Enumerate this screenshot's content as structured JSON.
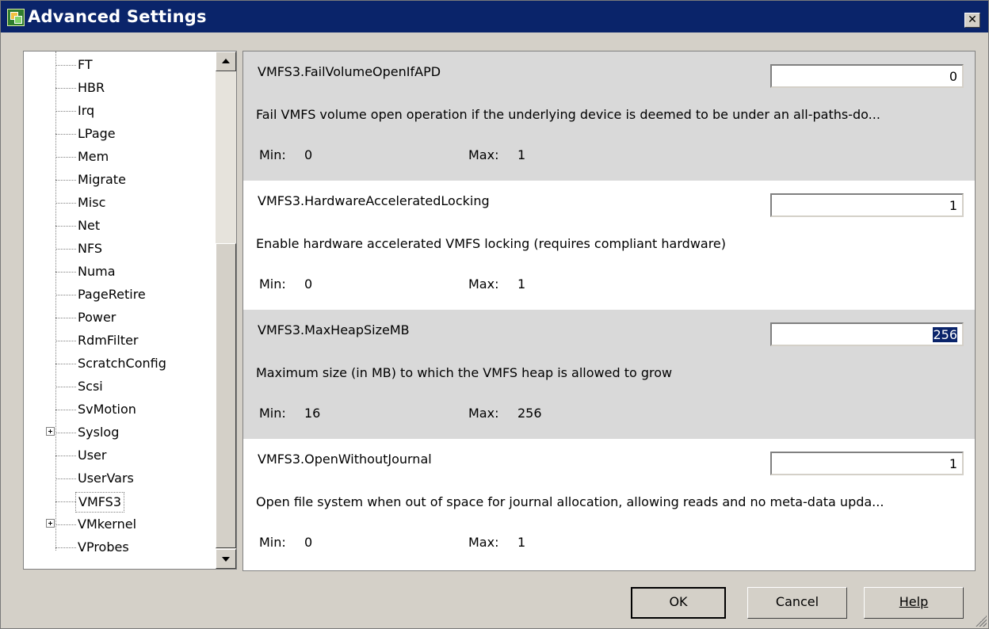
{
  "window": {
    "title": "Advanced Settings"
  },
  "tree": {
    "items": [
      {
        "label": "FT"
      },
      {
        "label": "HBR"
      },
      {
        "label": "Irq"
      },
      {
        "label": "LPage"
      },
      {
        "label": "Mem"
      },
      {
        "label": "Migrate"
      },
      {
        "label": "Misc"
      },
      {
        "label": "Net"
      },
      {
        "label": "NFS"
      },
      {
        "label": "Numa"
      },
      {
        "label": "PageRetire"
      },
      {
        "label": "Power"
      },
      {
        "label": "RdmFilter"
      },
      {
        "label": "ScratchConfig"
      },
      {
        "label": "Scsi"
      },
      {
        "label": "SvMotion"
      },
      {
        "label": "Syslog"
      },
      {
        "label": "User"
      },
      {
        "label": "UserVars"
      },
      {
        "label": "VMFS3"
      },
      {
        "label": "VMkernel"
      },
      {
        "label": "VProbes"
      }
    ],
    "selected": "VMFS3",
    "expandable": [
      "Syslog",
      "VMkernel"
    ]
  },
  "settings": [
    {
      "name": "VMFS3.FailVolumeOpenIfAPD",
      "value": "0",
      "description": "Fail VMFS volume open operation if the underlying device is deemed to be under an all-paths-do...",
      "min_label": "Min:",
      "min": "0",
      "max_label": "Max:",
      "max": "1"
    },
    {
      "name": "VMFS3.HardwareAcceleratedLocking",
      "value": "1",
      "description": "Enable hardware accelerated VMFS locking (requires compliant hardware)",
      "min_label": "Min:",
      "min": "0",
      "max_label": "Max:",
      "max": "1"
    },
    {
      "name": "VMFS3.MaxHeapSizeMB",
      "value": "256",
      "description": "Maximum size (in MB) to which the VMFS heap is allowed to grow",
      "min_label": "Min:",
      "min": "16",
      "max_label": "Max:",
      "max": "256"
    },
    {
      "name": "VMFS3.OpenWithoutJournal",
      "value": "1",
      "description": "Open file system when out of space for journal allocation, allowing reads and no meta-data upda...",
      "min_label": "Min:",
      "min": "0",
      "max_label": "Max:",
      "max": "1"
    }
  ],
  "buttons": {
    "ok": "OK",
    "cancel": "Cancel",
    "help": "Help"
  },
  "colors": {
    "titlebar": "#0a246a",
    "selection": "#0a246a",
    "alt_row": "#d9d9d9"
  }
}
